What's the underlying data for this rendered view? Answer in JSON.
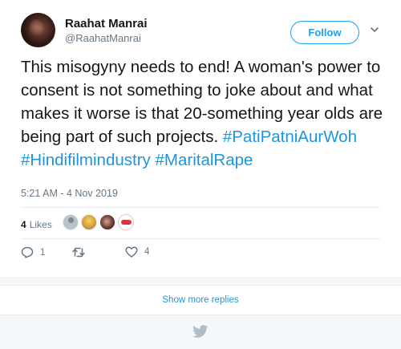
{
  "user": {
    "display_name": "Raahat Manrai",
    "handle": "@RaahatManrai"
  },
  "follow_button": {
    "label": "Follow"
  },
  "tweet": {
    "text_plain": "This misogyny needs to end! A woman's power to consent is not something to joke about and what makes it worse is that 20-something year olds are being part of such projects.",
    "hashtags": [
      "#PatiPatniAurWoh",
      "#Hindifilmindustry",
      "#MaritalRape"
    ],
    "timestamp": "5:21 AM - 4 Nov 2019"
  },
  "engagement": {
    "likes_count": "4",
    "likes_label": "Likes",
    "reply_count": "1",
    "like_action_count": "4"
  },
  "icons": {
    "more": "chevron-down-icon",
    "reply": "reply-icon",
    "retweet": "retweet-icon",
    "like": "heart-icon",
    "footer": "twitter-bird-icon"
  },
  "colors": {
    "accent": "#1da1f2",
    "hashtag": "#1b95e0",
    "muted": "#657786"
  },
  "footer": {
    "show_more_label": "Show more replies"
  }
}
